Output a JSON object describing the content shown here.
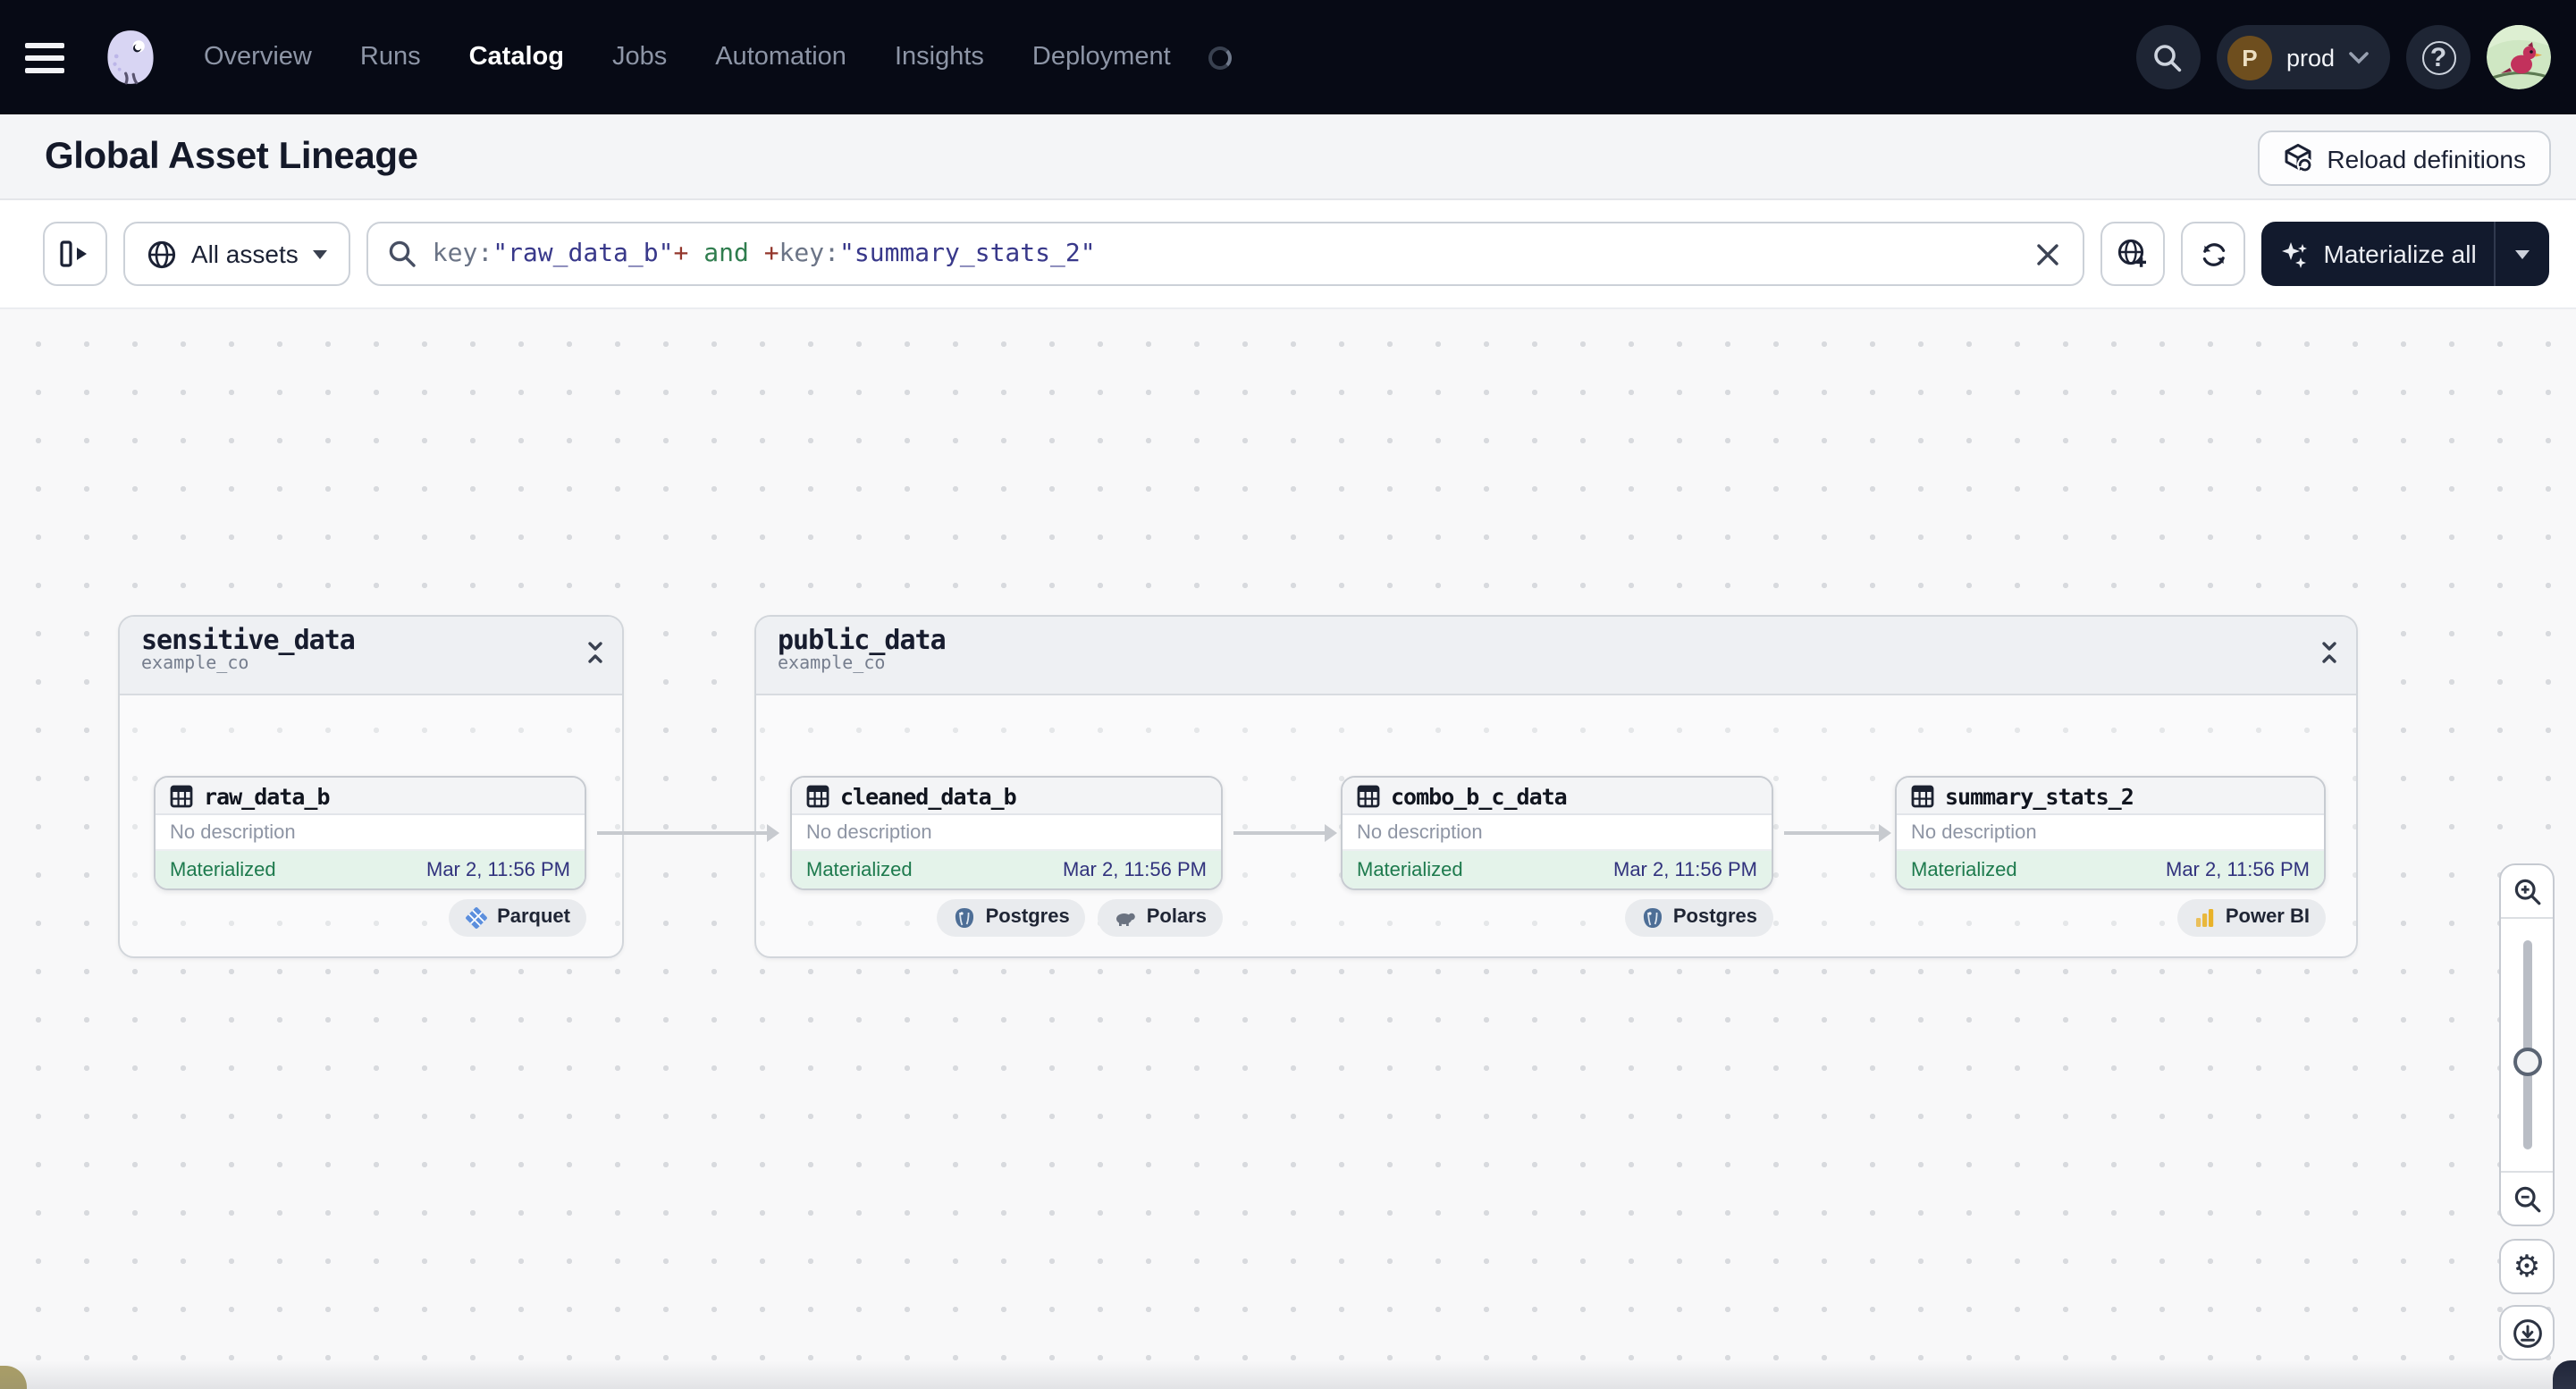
{
  "nav": {
    "items": [
      "Overview",
      "Runs",
      "Catalog",
      "Jobs",
      "Automation",
      "Insights",
      "Deployment"
    ],
    "active_item": "Catalog",
    "deployment_switcher": {
      "initial": "P",
      "label": "prod"
    },
    "help_glyph": "?"
  },
  "page_header": {
    "title": "Global Asset Lineage",
    "reload_button_label": "Reload definitions"
  },
  "toolbar": {
    "asset_scope_label": "All assets",
    "materialize_label": "Materialize all",
    "query_tokens": [
      {
        "text": "key:",
        "style": "field"
      },
      {
        "text": "\"raw_data_b\"",
        "style": "value"
      },
      {
        "text": "+",
        "style": "op"
      },
      {
        "text": " and ",
        "style": "keyword"
      },
      {
        "text": "+",
        "style": "op"
      },
      {
        "text": "key:",
        "style": "field"
      },
      {
        "text": "\"summary_stats_2\"",
        "style": "value"
      }
    ]
  },
  "groups": [
    {
      "name": "sensitive_data",
      "location": "example_co"
    },
    {
      "name": "public_data",
      "location": "example_co"
    }
  ],
  "assets": [
    {
      "name": "raw_data_b",
      "description": "No description",
      "status": "Materialized",
      "materialized_at": "Mar 2, 11:56 PM",
      "kinds": [
        "Parquet"
      ]
    },
    {
      "name": "cleaned_data_b",
      "description": "No description",
      "status": "Materialized",
      "materialized_at": "Mar 2, 11:56 PM",
      "kinds": [
        "Postgres",
        "Polars"
      ]
    },
    {
      "name": "combo_b_c_data",
      "description": "No description",
      "status": "Materialized",
      "materialized_at": "Mar 2, 11:56 PM",
      "kinds": [
        "Postgres"
      ]
    },
    {
      "name": "summary_stats_2",
      "description": "No description",
      "status": "Materialized",
      "materialized_at": "Mar 2, 11:56 PM",
      "kinds": [
        "Power BI"
      ]
    }
  ],
  "colors": {
    "nav_bg": "#070a15",
    "materialize_bg": "#121a2d",
    "status_green_text": "#1d7a4d",
    "status_green_bg": "#e4f3ea",
    "timestamp_indigo": "#31327d",
    "query_value": "#38388a",
    "query_op": "#93362c",
    "query_keyword": "#2f7d4e"
  }
}
